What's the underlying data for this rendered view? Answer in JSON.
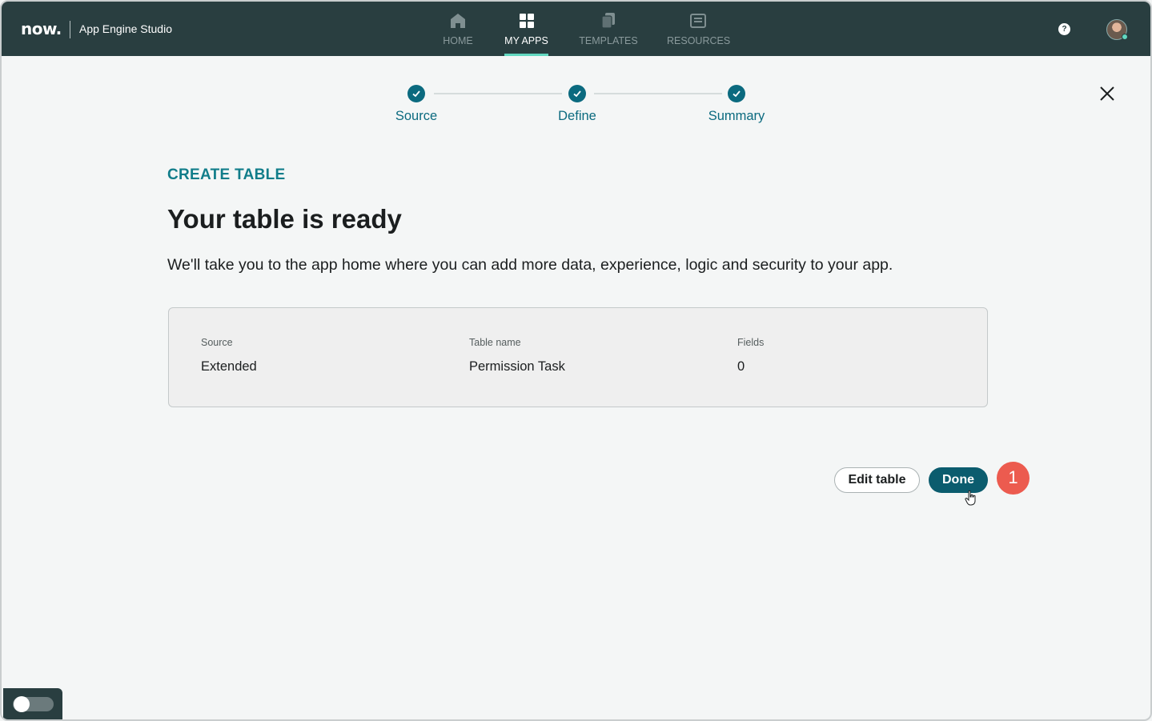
{
  "header": {
    "logo_text": "now.",
    "app_title": "App Engine Studio",
    "nav": [
      {
        "label": "HOME",
        "icon": "home-icon",
        "active": false
      },
      {
        "label": "MY APPS",
        "icon": "grid-icon",
        "active": true
      },
      {
        "label": "TEMPLATES",
        "icon": "templates-icon",
        "active": false
      },
      {
        "label": "RESOURCES",
        "icon": "resources-icon",
        "active": false
      }
    ],
    "help_glyph": "?"
  },
  "stepper": {
    "steps": [
      {
        "label": "Source",
        "status": "complete"
      },
      {
        "label": "Define",
        "status": "complete"
      },
      {
        "label": "Summary",
        "status": "complete"
      }
    ]
  },
  "content": {
    "eyebrow": "CREATE TABLE",
    "title": "Your table is ready",
    "subtitle": "We'll take you to the app home where you can add more data, experience, logic and security to your app."
  },
  "summary": {
    "source_label": "Source",
    "source_value": "Extended",
    "table_name_label": "Table name",
    "table_name_value": "Permission Task",
    "fields_label": "Fields",
    "fields_value": "0"
  },
  "actions": {
    "edit_label": "Edit table",
    "done_label": "Done"
  },
  "callout": {
    "number": "1"
  },
  "colors": {
    "header_bg": "#293e40",
    "accent": "#0b6a7f",
    "done_bg": "#0b5c6e",
    "callout": "#ec5b4f",
    "active_underline": "#62d8c0"
  }
}
